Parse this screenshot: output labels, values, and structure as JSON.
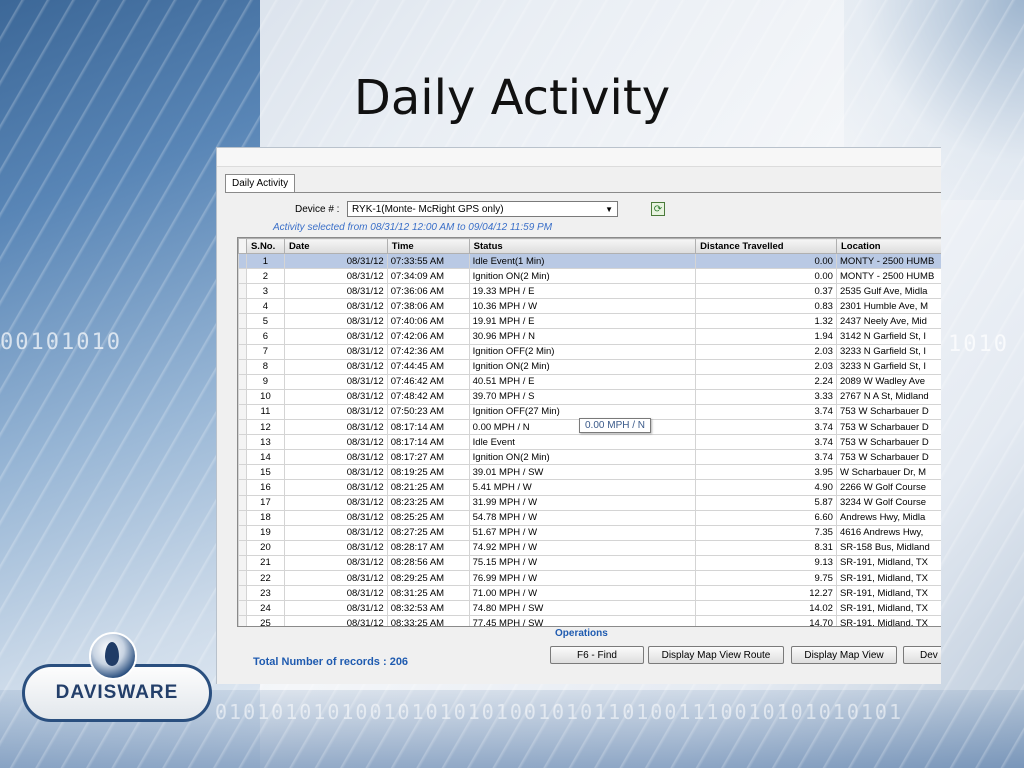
{
  "slide": {
    "title": "Daily Activity"
  },
  "window": {
    "tab_label": "Daily Activity",
    "device_label": "Device # :",
    "device_value": "RYK-1(Monte- McRight GPS only)",
    "activity_range": "Activity selected from 08/31/12 12:00 AM to 09/04/12 11:59 PM",
    "tooltip": "0.00 MPH / N",
    "operations_label": "Operations",
    "total_records": "Total Number of records : 206"
  },
  "grid": {
    "columns": [
      "S.No.",
      "Date",
      "Time",
      "Status",
      "Distance Travelled",
      "Location"
    ],
    "rows": [
      [
        "1",
        "08/31/12",
        "07:33:55 AM",
        "Idle Event(1 Min)",
        "0.00",
        "MONTY - 2500 HUMB"
      ],
      [
        "2",
        "08/31/12",
        "07:34:09 AM",
        "Ignition ON(2 Min)",
        "0.00",
        "MONTY - 2500 HUMB"
      ],
      [
        "3",
        "08/31/12",
        "07:36:06 AM",
        "19.33 MPH / E",
        "0.37",
        "2535 Gulf Ave, Midla"
      ],
      [
        "4",
        "08/31/12",
        "07:38:06 AM",
        "10.36 MPH / W",
        "0.83",
        "2301 Humble Ave, M"
      ],
      [
        "5",
        "08/31/12",
        "07:40:06 AM",
        "19.91 MPH / E",
        "1.32",
        "2437 Neely Ave, Mid"
      ],
      [
        "6",
        "08/31/12",
        "07:42:06 AM",
        "30.96 MPH / N",
        "1.94",
        "3142 N Garfield St, I"
      ],
      [
        "7",
        "08/31/12",
        "07:42:36 AM",
        "Ignition OFF(2 Min)",
        "2.03",
        "3233 N Garfield St, I"
      ],
      [
        "8",
        "08/31/12",
        "07:44:45 AM",
        "Ignition ON(2 Min)",
        "2.03",
        "3233 N Garfield St, I"
      ],
      [
        "9",
        "08/31/12",
        "07:46:42 AM",
        "40.51 MPH / E",
        "2.24",
        "2089 W Wadley Ave"
      ],
      [
        "10",
        "08/31/12",
        "07:48:42 AM",
        "39.70 MPH / S",
        "3.33",
        "2767 N A St, Midland"
      ],
      [
        "11",
        "08/31/12",
        "07:50:23 AM",
        "Ignition OFF(27 Min)",
        "3.74",
        "753 W Scharbauer D"
      ],
      [
        "12",
        "08/31/12",
        "08:17:14 AM",
        "0.00 MPH / N",
        "3.74",
        "753 W Scharbauer D"
      ],
      [
        "13",
        "08/31/12",
        "08:17:14 AM",
        "Idle Event",
        "3.74",
        "753 W Scharbauer D"
      ],
      [
        "14",
        "08/31/12",
        "08:17:27 AM",
        "Ignition ON(2 Min)",
        "3.74",
        "753 W Scharbauer D"
      ],
      [
        "15",
        "08/31/12",
        "08:19:25 AM",
        "39.01 MPH / SW",
        "3.95",
        "W Scharbauer Dr, M"
      ],
      [
        "16",
        "08/31/12",
        "08:21:25 AM",
        "5.41 MPH / W",
        "4.90",
        "2266 W Golf Course"
      ],
      [
        "17",
        "08/31/12",
        "08:23:25 AM",
        "31.99 MPH / W",
        "5.87",
        "3234 W Golf Course"
      ],
      [
        "18",
        "08/31/12",
        "08:25:25 AM",
        "54.78 MPH / W",
        "6.60",
        "Andrews Hwy, Midla"
      ],
      [
        "19",
        "08/31/12",
        "08:27:25 AM",
        "51.67 MPH / W",
        "7.35",
        "4616 Andrews Hwy,"
      ],
      [
        "20",
        "08/31/12",
        "08:28:17 AM",
        "74.92 MPH / W",
        "8.31",
        "SR-158 Bus, Midland"
      ],
      [
        "21",
        "08/31/12",
        "08:28:56 AM",
        "75.15 MPH / W",
        "9.13",
        "SR-191, Midland, TX"
      ],
      [
        "22",
        "08/31/12",
        "08:29:25 AM",
        "76.99 MPH / W",
        "9.75",
        "SR-191, Midland, TX"
      ],
      [
        "23",
        "08/31/12",
        "08:31:25 AM",
        "71.00 MPH / W",
        "12.27",
        "SR-191, Midland, TX"
      ],
      [
        "24",
        "08/31/12",
        "08:32:53 AM",
        "74.80 MPH / SW",
        "14.02",
        "SR-191, Midland, TX"
      ],
      [
        "25",
        "08/31/12",
        "08:33:25 AM",
        "77.45 MPH / SW",
        "14.70",
        "SR-191, Midland, TX"
      ]
    ]
  },
  "buttons": {
    "find": "F6 - Find",
    "map_route": "Display Map View Route",
    "map_view": "Display Map View",
    "dev": "Dev"
  },
  "logo": {
    "text": "DAVISWARE"
  },
  "decor": {
    "binary_left": "00101010",
    "binary_right": "1010",
    "binary_bottom": "0101010101001010101010010101101001110010101010101"
  }
}
